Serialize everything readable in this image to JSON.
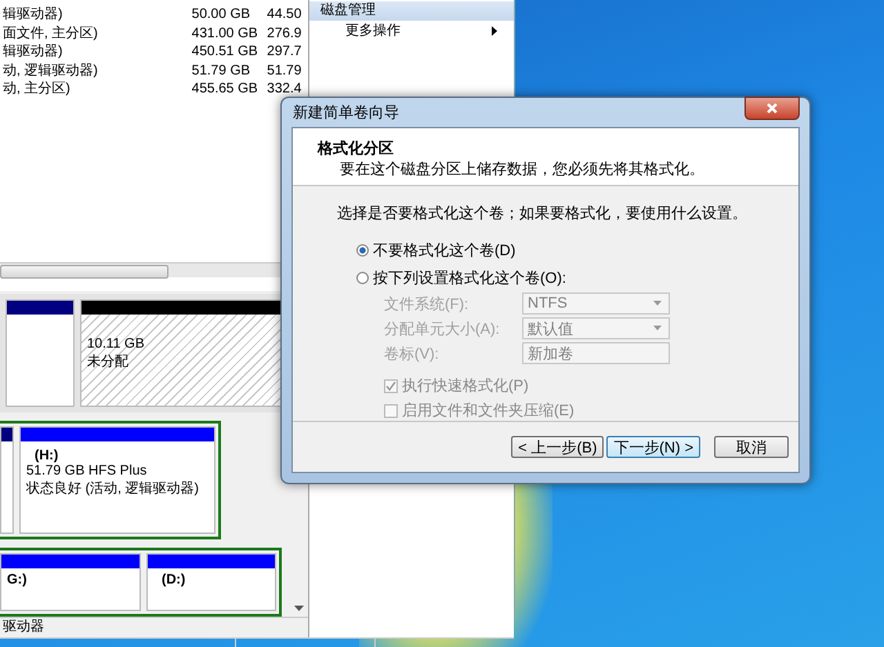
{
  "disk_management": {
    "volume_list": {
      "rows": [
        {
          "column_1": "辑驱动器)",
          "column_2": "50.00 GB",
          "column_3": "44.50"
        },
        {
          "column_1": "面文件, 主分区)",
          "column_2": "431.00 GB",
          "column_3": "276.9"
        },
        {
          "column_1": "辑驱动器)",
          "column_2": "450.51 GB",
          "column_3": "297.7"
        },
        {
          "column_1": "动, 逻辑驱动器)",
          "column_2": "51.79 GB",
          "column_3": "51.79"
        },
        {
          "column_1": "动, 主分区)",
          "column_2": "455.65 GB",
          "column_3": "332.4"
        }
      ]
    },
    "actions": {
      "header": "磁盘管理",
      "items": [
        {
          "label": "更多操作",
          "has_submenu": true
        }
      ]
    },
    "disk_map": {
      "disks": [
        {
          "extended": false,
          "partitions": [
            {
              "kind": "primary"
            },
            {
              "kind": "unallocated",
              "lines": [
                "10.11 GB",
                "未分配"
              ]
            }
          ]
        },
        {
          "extended": true,
          "partitions": [
            {
              "kind": "primary"
            },
            {
              "kind": "logical",
              "name": "(H:)",
              "lines": [
                "51.79 GB HFS Plus",
                "状态良好 (活动, 逻辑驱动器)"
              ]
            }
          ]
        },
        {
          "extended": true,
          "partitions": [
            {
              "kind": "logical",
              "name": "G:)"
            },
            {
              "kind": "logical",
              "name": "(D:)"
            }
          ]
        }
      ],
      "legend": [
        "驱动器"
      ]
    }
  },
  "dialog": {
    "title": "新建简单卷向导",
    "heading": "格式化分区",
    "subheading": "要在这个磁盘分区上储存数据，您必须先将其格式化。",
    "instruction": "选择是否要格式化这个卷；如果要格式化，要使用什么设置。",
    "options": [
      {
        "label": "不要格式化这个卷(D)",
        "selected": true
      },
      {
        "label": "按下列设置格式化这个卷(O):",
        "selected": false
      }
    ],
    "fields": [
      {
        "kind": "dropdown",
        "label": "文件系统(F):",
        "value": "NTFS",
        "disabled": true
      },
      {
        "kind": "dropdown",
        "label": "分配单元大小(A):",
        "value": "默认值",
        "disabled": true
      },
      {
        "kind": "text",
        "label": "卷标(V):",
        "value": "新加卷",
        "disabled": true
      }
    ],
    "checkboxes": [
      {
        "label": "执行快速格式化(P)",
        "checked": true,
        "disabled": true
      },
      {
        "label": "启用文件和文件夹压缩(E)",
        "checked": false,
        "disabled": true
      }
    ],
    "buttons": [
      {
        "label": "< 上一步(B)",
        "default": false
      },
      {
        "label": "下一步(N) >",
        "default": true
      },
      {
        "label": "取消",
        "default": false
      }
    ]
  }
}
